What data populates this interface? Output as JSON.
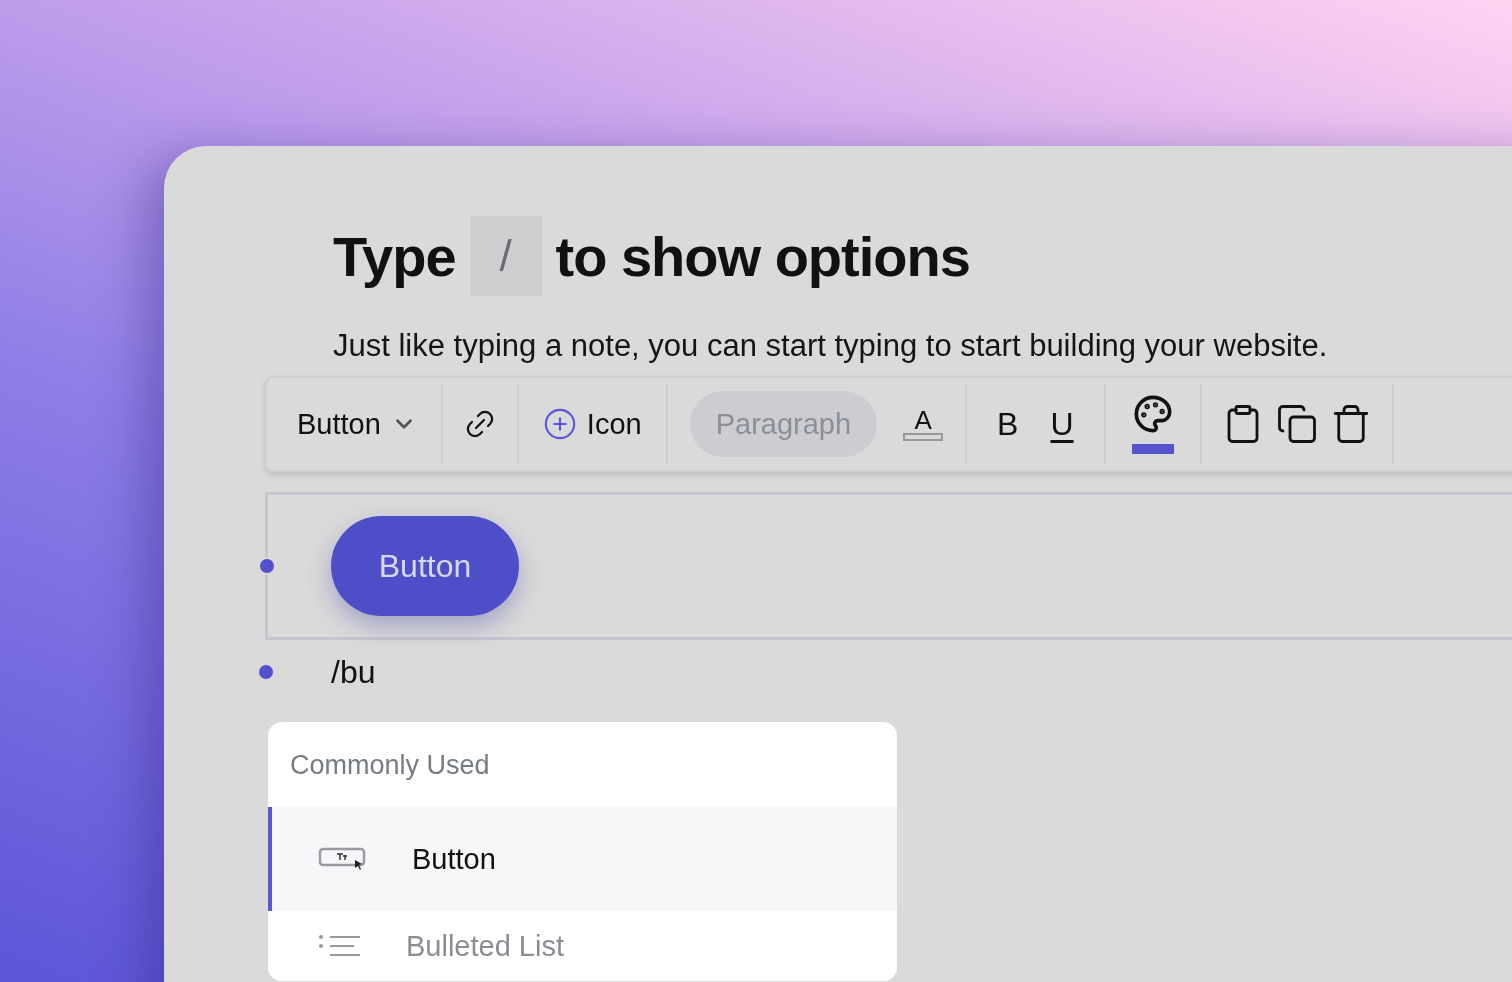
{
  "heading": {
    "before": "Type",
    "key": "/",
    "after": "to show options"
  },
  "paragraph": "Just like typing a note, you can start typing to start building your website.",
  "toolbar": {
    "block_type": "Button",
    "insert_icon": "Icon",
    "text_style": "Paragraph",
    "text_color": "A",
    "bold": "B",
    "underline": "U",
    "color_picker_active": true
  },
  "canvas": {
    "button_block": {
      "label": "Button",
      "selected": true
    },
    "typed_text": "/bu"
  },
  "menu": {
    "section": "Commonly Used",
    "items": [
      {
        "kind": "button",
        "label": "Button",
        "selected": true
      },
      {
        "kind": "list",
        "label": "Bulleted List",
        "selected": false
      }
    ]
  }
}
